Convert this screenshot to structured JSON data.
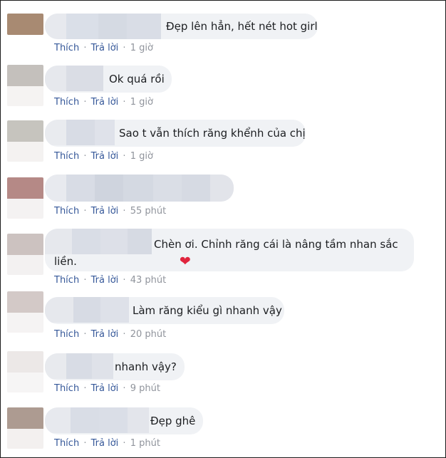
{
  "actions": {
    "like": "Thích",
    "reply": "Trả lời",
    "separator": "·"
  },
  "colors": {
    "bubble": "#f0f2f5",
    "link": "#365899",
    "heart": "#e0243d"
  },
  "comments": [
    {
      "text": "Đẹp lên hẳn, hết nét hot girl",
      "time": "1 giờ"
    },
    {
      "text": "Ok quá rồi",
      "time": "1 giờ"
    },
    {
      "text": "Sao t vẫn thích răng khểnh của chị",
      "time": "1 giờ"
    },
    {
      "text": "",
      "time": "55 phút"
    },
    {
      "text": "Chèn ơi. Chỉnh răng cái là nâng tầm nhan sắc liền.",
      "emoji": "heart-icon",
      "time": "43 phút"
    },
    {
      "text": "Làm răng kiểu gì nhanh vậy",
      "time": "20 phút"
    },
    {
      "text": "nhanh vậy?",
      "time": "9 phút"
    },
    {
      "text": "Đẹp ghê",
      "time": "1 phút"
    }
  ]
}
